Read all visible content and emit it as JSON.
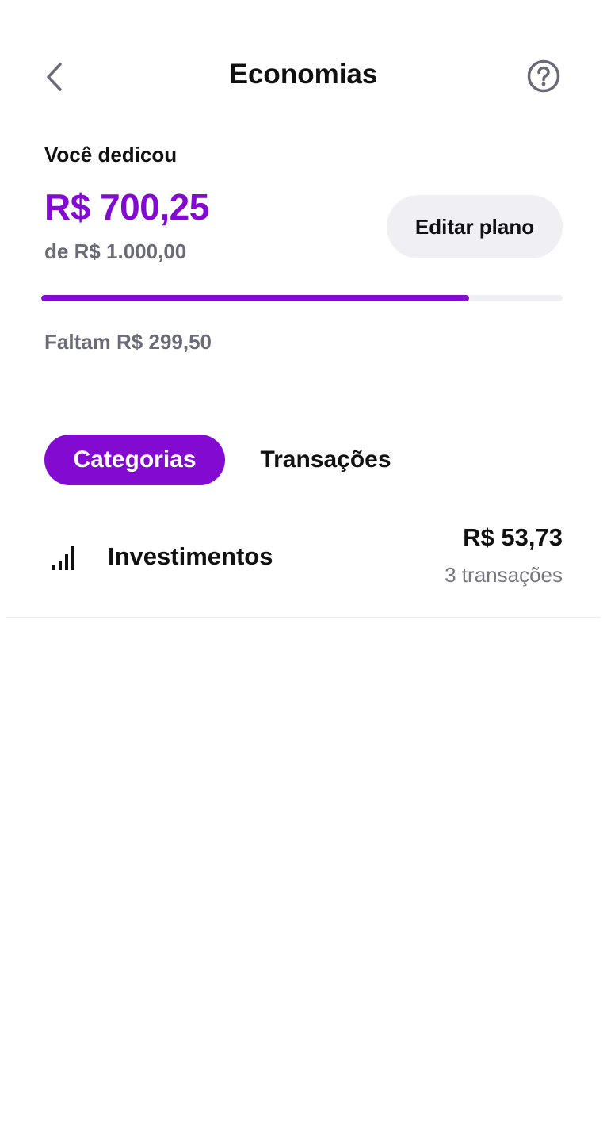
{
  "colors": {
    "accent": "#820ad1",
    "muted_text": "#6b6b78",
    "chip_background": "#efeff4"
  },
  "header": {
    "back_icon": "chevron-left-icon",
    "title": "Economias",
    "help_icon": "question-circle-icon"
  },
  "summary": {
    "label": "Você dedicou",
    "amount": "R$ 700,25",
    "goal": "de R$ 1.000,00",
    "edit_button_label": "Editar plano",
    "progress_fraction": 0.82,
    "remaining": "Faltam R$ 299,50"
  },
  "tabs": [
    {
      "label": "Categorias",
      "active": true
    },
    {
      "label": "Transações",
      "active": false
    }
  ],
  "categories": [
    {
      "icon": "signal-bars-icon",
      "name": "Investimentos",
      "amount": "R$ 53,73",
      "count": "3 transações"
    }
  ]
}
